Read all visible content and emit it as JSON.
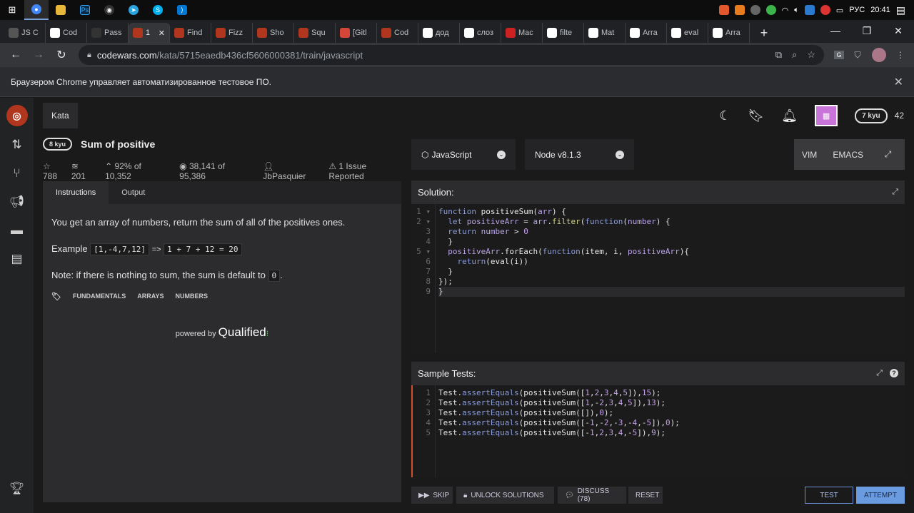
{
  "taskbar": {
    "icons": [
      "windows-logo",
      "chrome",
      "file-explorer",
      "photoshop",
      "obs",
      "telegram",
      "skype",
      "vscode"
    ],
    "tray": {
      "language": "РУС",
      "time": "20:41"
    }
  },
  "browser": {
    "tabs": [
      {
        "label": "JS C",
        "color": "#555"
      },
      {
        "label": "Cod",
        "color": "#fff"
      },
      {
        "label": "Pass",
        "color": "#333"
      },
      {
        "label": "1",
        "color": "#b1361e"
      },
      {
        "label": "Find",
        "color": "#b1361e"
      },
      {
        "label": "Fizz",
        "color": "#b1361e"
      },
      {
        "label": "Sho",
        "color": "#b1361e"
      },
      {
        "label": "Squ",
        "color": "#b1361e"
      },
      {
        "label": "[Gitl",
        "color": "#d44638"
      },
      {
        "label": "Cod",
        "color": "#b1361e"
      },
      {
        "label": "дод",
        "color": "#fff"
      },
      {
        "label": "слоз",
        "color": "#fff"
      },
      {
        "label": "Mac",
        "color": "#c22"
      },
      {
        "label": "filte",
        "color": "#fff"
      },
      {
        "label": "Mat",
        "color": "#fff"
      },
      {
        "label": "Arra",
        "color": "#fff"
      },
      {
        "label": "eval",
        "color": "#fff"
      },
      {
        "label": "Arra",
        "color": "#fff"
      }
    ],
    "active_tab_index": 3,
    "url_host": "codewars.com",
    "url_path": "/kata/5715eaedb436cf5606000381/train/javascript",
    "infobar_text": "Браузером Chrome управляет автоматизированное тестовое ПО."
  },
  "header": {
    "section": "Kata",
    "user_rank": "7 kyu",
    "honor": "42"
  },
  "kata": {
    "rank": "8 kyu",
    "title": "Sum of positive",
    "stars": "788",
    "collections": "201",
    "satisfaction": "92% of 10,352",
    "completions": "38,141 of 95,386",
    "author": "JbPasquier",
    "issues": "1 Issue Reported"
  },
  "left_panel": {
    "tabs": [
      "Instructions",
      "Output"
    ],
    "description": "You get an array of numbers, return the sum of all of the positives ones.",
    "example_label": "Example",
    "example_input": "[1,-4,7,12]",
    "example_arrow": "=>",
    "example_output": "1 + 7 + 12 = 20",
    "note_text": "Note: if there is nothing to sum, the sum is default to",
    "note_code": "0",
    "note_end": ".",
    "tags": [
      "FUNDAMENTALS",
      "ARRAYS",
      "NUMBERS"
    ],
    "powered_by": "powered by",
    "powered_brand": "Qualified"
  },
  "editor_bar": {
    "language": "JavaScript",
    "runtime": "Node v8.1.3",
    "modes": [
      "VIM",
      "EMACS"
    ]
  },
  "solution": {
    "title": "Solution:",
    "line_numbers": [
      "1",
      "2",
      "3",
      "4",
      "5",
      "6",
      "7",
      "8",
      "9"
    ]
  },
  "sample_tests": {
    "title": "Sample Tests:",
    "line_numbers": [
      "1",
      "2",
      "3",
      "4",
      "5"
    ]
  },
  "bottom": {
    "skip": "SKIP",
    "unlock": "UNLOCK SOLUTIONS",
    "discuss": "DISCUSS (78)",
    "reset": "RESET",
    "test": "TEST",
    "attempt": "ATTEMPT"
  }
}
